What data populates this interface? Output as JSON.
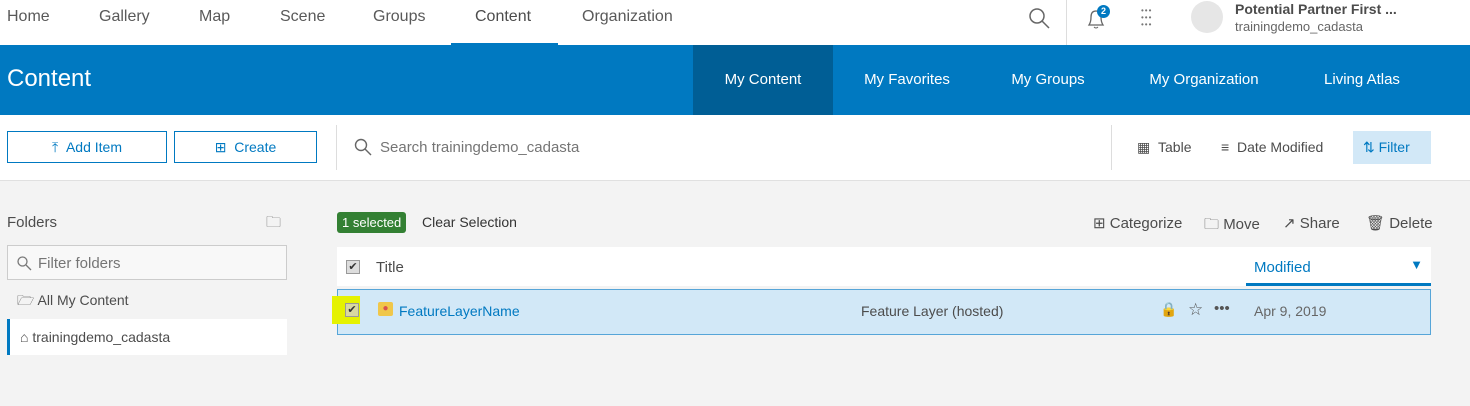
{
  "topnav": {
    "items": [
      "Home",
      "Gallery",
      "Map",
      "Scene",
      "Groups",
      "Content",
      "Organization"
    ],
    "active": "Content",
    "notifications": "2",
    "user_name": "Potential Partner First ...",
    "username": "trainingdemo_cadasta"
  },
  "header": {
    "title": "Content",
    "tabs": [
      "My Content",
      "My Favorites",
      "My Groups",
      "My Organization",
      "Living Atlas"
    ],
    "active": "My Content",
    "color": "#0079c1"
  },
  "toolbar": {
    "add_item": "Add Item",
    "create": "Create",
    "search_placeholder": "Search trainingdemo_cadasta",
    "table": "Table",
    "sort": "Date Modified",
    "filter": "Filter"
  },
  "sidebar": {
    "title": "Folders",
    "filter_placeholder": "Filter folders",
    "items": [
      "All My Content",
      "trainingdemo_cadasta"
    ],
    "active": "trainingdemo_cadasta"
  },
  "selection": {
    "badge": "1 selected",
    "clear": "Clear Selection"
  },
  "actions": {
    "categorize": "Categorize",
    "move": "Move",
    "share": "Share",
    "delete": "Delete"
  },
  "table": {
    "col_title": "Title",
    "col_modified": "Modified",
    "rows": [
      {
        "title": "FeatureLayerName",
        "type": "Feature Layer (hosted)",
        "modified": "Apr 9, 2019",
        "selected": true
      }
    ]
  }
}
